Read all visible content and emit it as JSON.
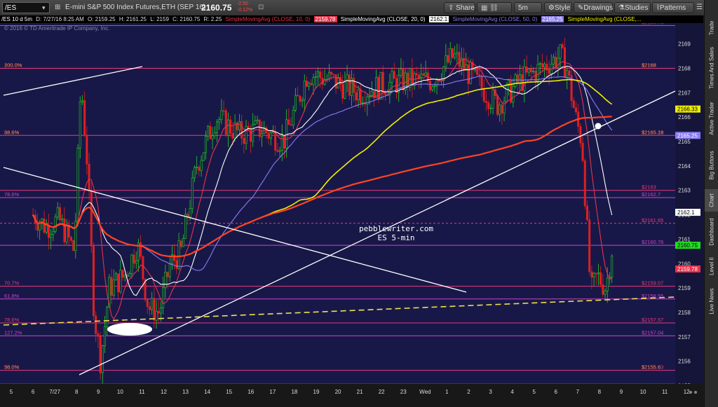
{
  "toolbar": {
    "symbol": "/ES",
    "description": "E-mini S&P 500 Index Futures,ETH (SEP 16)",
    "last_price": "2160.75",
    "change": "-2.50",
    "change_pct": "-0.12%",
    "share_label": "Share",
    "interval": "5m",
    "style_label": "Style",
    "drawings_label": "Drawings",
    "studies_label": "Studies",
    "patterns_label": "Patterns"
  },
  "studies_bar": {
    "header": "/ES 10 d 5m",
    "date": "D: 7/27/16 8:25 AM",
    "open": "O: 2159.25",
    "high": "H: 2161.25",
    "low": "L: 2159",
    "close": "C: 2160.75",
    "range": "R: 2.25",
    "sma10_label": "SimpleMovingAvg (CLOSE, 10, 0)",
    "sma10_value": "2159.78",
    "sma20_label": "SimpleMovingAvg (CLOSE, 20, 0)",
    "sma20_value": "2162.1",
    "sma50_label": "SimpleMovingAvg (CLOSE, 50, 0)",
    "sma50_value": "2165.25",
    "sma_last_label": "SimpleMovingAvg (CLOSE,..."
  },
  "copyright": "© 2016 © TD Ameritrade IP Company, Inc.",
  "watermark": {
    "line1": "pebblewriter.com",
    "line2": "ES 5-min"
  },
  "chart_data": {
    "type": "candlestick",
    "x_ticks": [
      "5",
      "6",
      "7/27",
      "8",
      "9",
      "10",
      "11",
      "12",
      "13",
      "14",
      "15",
      "16",
      "17",
      "18",
      "19",
      "20",
      "21",
      "22",
      "23",
      "Wed",
      "1",
      "2",
      "3",
      "4",
      "5",
      "6",
      "7",
      "8",
      "9",
      "10",
      "11",
      "12"
    ],
    "y_ticks": [
      2154,
      2155,
      2156,
      2157,
      2158,
      2159,
      2160,
      2161,
      2162,
      2163,
      2164,
      2165,
      2166,
      2167,
      2168,
      2169
    ],
    "ylim": [
      2153.4,
      2169.85
    ],
    "close_path": [
      [
        1,
        2162
      ],
      [
        1.6,
        2161.5
      ],
      [
        2.2,
        2161.8
      ],
      [
        2.9,
        2160.5
      ],
      [
        3.2,
        2167.5
      ],
      [
        3.5,
        2164
      ],
      [
        3.8,
        2158
      ],
      [
        4.1,
        2156
      ],
      [
        4.5,
        2159
      ],
      [
        5.2,
        2159.5
      ],
      [
        5.8,
        2160.8
      ],
      [
        6.3,
        2158.2
      ],
      [
        6.8,
        2158
      ],
      [
        7.3,
        2160
      ],
      [
        7.8,
        2160.5
      ],
      [
        8.5,
        2164
      ],
      [
        9.4,
        2166
      ],
      [
        10.5,
        2165.3
      ],
      [
        11.5,
        2165.5
      ],
      [
        12.5,
        2165
      ],
      [
        13.6,
        2167.8
      ],
      [
        14.7,
        2167.5
      ],
      [
        16,
        2167
      ],
      [
        17,
        2167.3
      ],
      [
        18.2,
        2167.5
      ],
      [
        19.3,
        2167.5
      ],
      [
        20.3,
        2168.5
      ],
      [
        21.3,
        2167.5
      ],
      [
        22.3,
        2166.5
      ],
      [
        23.4,
        2167.5
      ],
      [
        24.3,
        2168
      ],
      [
        25.2,
        2168.5
      ],
      [
        25.5,
        2168
      ],
      [
        25.9,
        2166
      ],
      [
        26.2,
        2165
      ],
      [
        26.6,
        2158.8
      ],
      [
        26.9,
        2159.5
      ],
      [
        27.3,
        2159
      ],
      [
        27.6,
        2160.75
      ]
    ],
    "moving_averages": [
      {
        "name": "SimpleMovingAvg (CLOSE, 10, 0)",
        "last": "2159.78",
        "color": "#e8314a"
      },
      {
        "name": "SimpleMovingAvg (CLOSE, 20, 0)",
        "last": "2162.1",
        "color": "#ffffff"
      },
      {
        "name": "SimpleMovingAvg (CLOSE, 50, 0)",
        "last": "2165.25",
        "color": "#8a7cf0"
      },
      {
        "name": "SimpleMovingAvg (CLOSE,...",
        "last": "2166.33",
        "color": "#f0f000"
      },
      {
        "name": "",
        "last": "",
        "color": "#ff4422"
      }
    ],
    "price_tags": [
      {
        "label": "2166.33",
        "value": 2166.33,
        "bg": "#f0f000",
        "fg": "#000"
      },
      {
        "label": "2165.25",
        "value": 2165.25,
        "bg": "#8a7cf0",
        "fg": "#fff"
      },
      {
        "label": "2162.1",
        "value": 2162.1,
        "bg": "#ffffff",
        "fg": "#000"
      },
      {
        "label": "2160.75",
        "value": 2160.75,
        "bg": "#22dd22",
        "fg": "#000"
      },
      {
        "label": "2159.78",
        "value": 2159.78,
        "bg": "#e8314a",
        "fg": "#fff"
      }
    ],
    "levels": [
      {
        "price": 2169.75,
        "right": "$2169.73",
        "left": "",
        "color": "#e83a7a"
      },
      {
        "price": 2168.0,
        "right": "$2168",
        "right2": "$2168",
        "left": "100.0%",
        "left2": "200.0%",
        "color": "#e83a7a"
      },
      {
        "price": 2165.25,
        "right": "$2165.24",
        "right2": "$2165.18",
        "left": "88.6%",
        "left2": "38.6%",
        "color": "#e83a7a"
      },
      {
        "price": 2163.0,
        "right": "$2163",
        "left": "",
        "color": "#e83a7a"
      },
      {
        "price": 2162.7,
        "right": "$2162.7",
        "left": "78.6%",
        "color": "#cc44cc"
      },
      {
        "price": 2161.65,
        "right": "$2161.65",
        "left": "",
        "color": "#e83a7a",
        "dashed": true
      },
      {
        "price": 2160.75,
        "right": "$2160.76",
        "left": "",
        "color": "#cc44cc"
      },
      {
        "price": 2159.07,
        "right": "$2159.07",
        "left": "70.7%",
        "color": "#e83a7a"
      },
      {
        "price": 2158.55,
        "right": "$2158.55",
        "left": "61.8%",
        "color": "#cc44cc"
      },
      {
        "price": 2157.57,
        "right": "$2157.57",
        "left": "78.6%",
        "color": "#e83a7a"
      },
      {
        "price": 2157.04,
        "right": "$2157.04",
        "left": "127.2%",
        "color": "#cc44cc"
      },
      {
        "price": 2155.63,
        "right": "$2155.63",
        "right2": "$2155.6",
        "left": "50.0%",
        "left2": "38.0%",
        "color": "#e83a7a"
      },
      {
        "price": 2153.5,
        "right": "$2153.5",
        "left": "100.0%",
        "color": "#e83a7a"
      }
    ]
  },
  "right_tabs": [
    "Trade",
    "Times And Sales",
    "Active Trader",
    "Big Buttons",
    "Chart",
    "Dashboard",
    "Level II",
    "Live News"
  ]
}
